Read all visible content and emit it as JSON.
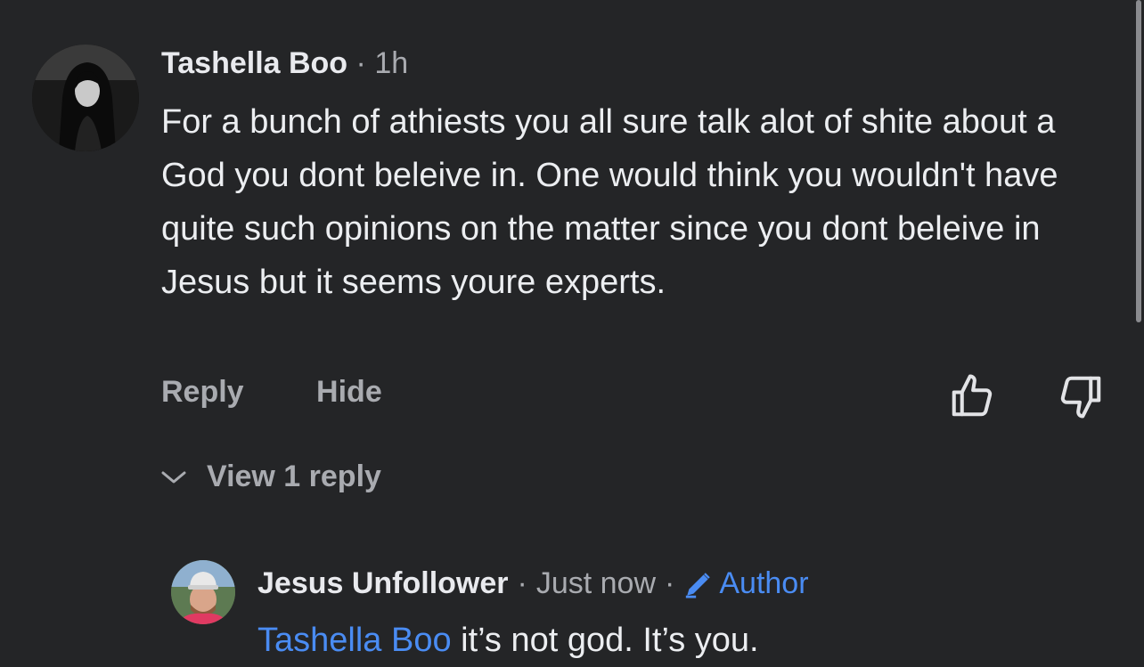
{
  "comment": {
    "author": "Tashella Boo",
    "separator": "·",
    "time": "1h",
    "text": "For a bunch of athiests you all sure talk alot of shite about a God you dont beleive in. One would think you wouldn't have quite such opinions on the matter since you dont beleive in Jesus but it seems youre experts.",
    "actions": {
      "reply": "Reply",
      "hide": "Hide"
    },
    "upvote_icon": "thumbs-up-icon",
    "downvote_icon": "thumbs-down-icon",
    "view_replies": "View 1 reply"
  },
  "reply": {
    "author": "Jesus Unfollower",
    "separator": "·",
    "time": "Just now",
    "separator2": "·",
    "badge": "Author",
    "badge_icon": "pencil-icon",
    "mention": "Tashella Boo",
    "text": " it’s not god. It’s you."
  },
  "colors": {
    "background": "#242527",
    "text": "#eceef1",
    "muted": "#a9abb0",
    "accent": "#4a8cf3"
  }
}
